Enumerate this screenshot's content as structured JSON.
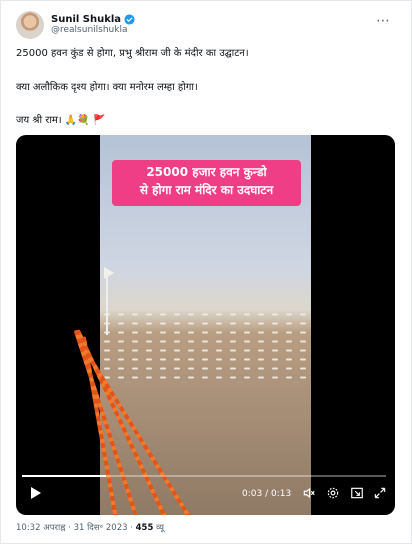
{
  "post": {
    "author_name": "Sunil Shukla",
    "author_handle": "@realsunilshukla",
    "line1": "25000 हवन कुंड से होगा, प्रभु श्रीराम जी के मंदीर का उद्घाटन।",
    "line2": "क्या अलौकिक दृश्य होगा। क्या मनोरम लम्हा होगा।",
    "line3": "जय श्री राम। 🙏💐 🚩",
    "more_icon": "⋯"
  },
  "video": {
    "overlay_line1": "25000  हजार हवन कुन्डो",
    "overlay_line2": "से होगा राम मंदिर का उदघाटन",
    "time": "0:03 / 0:13",
    "progress_fraction": 0.23,
    "icons": [
      "play-icon",
      "volume-icon",
      "settings-icon",
      "pip-icon",
      "fullscreen-icon"
    ]
  },
  "meta": {
    "timestamp": "10:32 अपराह्न · 31 दिस॰ 2023 · ",
    "views_count": "455",
    "views_label": " व्यू"
  },
  "colors": {
    "overlay": "#ef3d86",
    "verified": "#1d9bf0",
    "muted": "#536471"
  }
}
